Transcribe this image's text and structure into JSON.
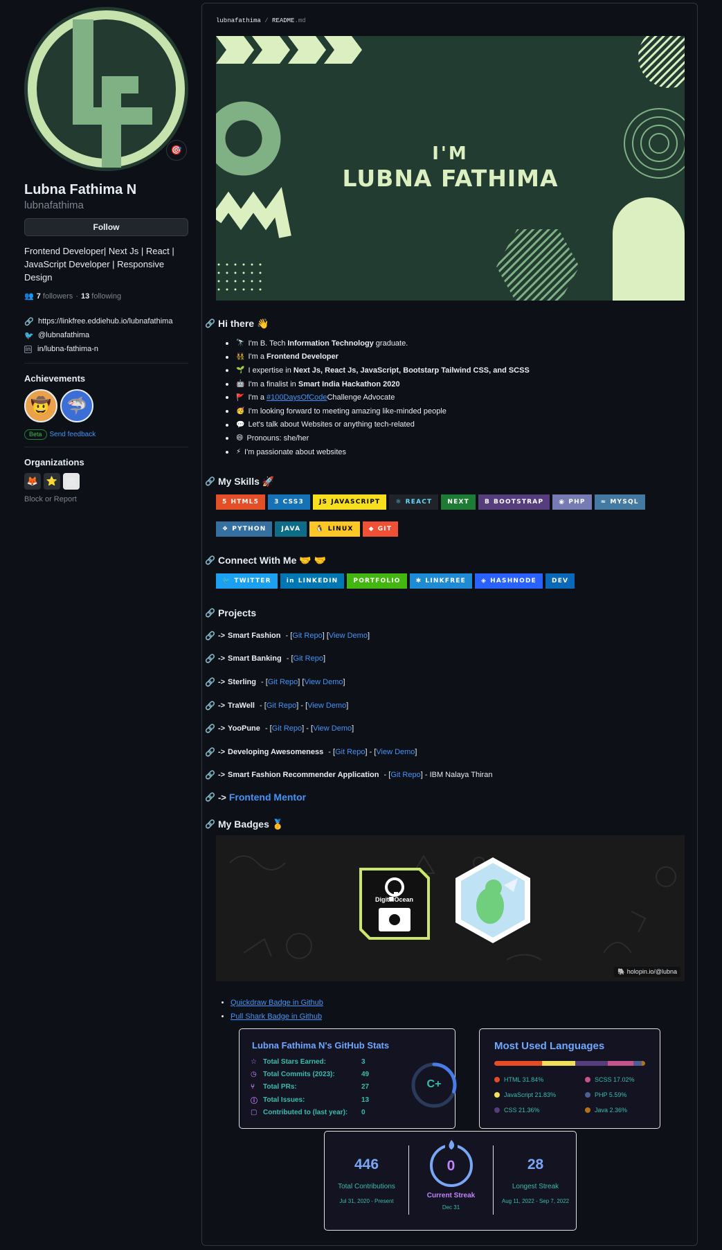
{
  "profile": {
    "full_name": "Lubna Fathima N",
    "login": "lubnafathima",
    "follow_label": "Follow",
    "bio": "Frontend Developer| Next Js | React | JavaScript Developer | Responsive Design",
    "followers_count": "7",
    "followers_label": "followers",
    "following_count": "13",
    "following_label": "following",
    "website": "https://linkfree.eddiehub.io/lubnafathima",
    "twitter": "@lubnafathima",
    "linkedin": "in/lubna-fathima-n",
    "status_emoji": "🎯"
  },
  "achievements": {
    "title": "Achievements",
    "items": [
      {
        "emoji": "🤠",
        "name": "Quickdraw"
      },
      {
        "emoji": "🦈",
        "name": "Pull Shark"
      }
    ],
    "beta_label": "Beta",
    "feedback_label": "Send feedback"
  },
  "organizations": {
    "title": "Organizations",
    "items": [
      "🦊",
      "⭐",
      "🏛"
    ],
    "block_report": "Block or Report"
  },
  "readme": {
    "owner": "lubnafathima",
    "file": "README",
    "ext": ".md",
    "banner_line1": "I'M",
    "banner_line2": "LUBNA FATHIMA",
    "hi_title": "Hi there",
    "hi_emoji": "👋",
    "intro": [
      {
        "emoji": "🔭",
        "pre": "I'm B. Tech ",
        "bold": "Information Technology",
        "post": " graduate."
      },
      {
        "emoji": "👯",
        "pre": "I'm a ",
        "bold": "Frontend Developer",
        "post": ""
      },
      {
        "emoji": "🌱",
        "pre": "I expertise in ",
        "bold": "Next Js, React Js, JavaScript, Bootstarp Tailwind CSS, and SCSS",
        "post": ""
      },
      {
        "emoji": "🤖",
        "pre": "I'm a finalist in ",
        "bold": "Smart India Hackathon 2020",
        "post": ""
      },
      {
        "emoji": "🚩",
        "pre": "I'm a ",
        "link": "#100DaysOfCode",
        "post": " Challenge Advocate"
      },
      {
        "emoji": "🥳",
        "pre": "I'm looking forward to meeting amazing like-minded people",
        "post": ""
      },
      {
        "emoji": "💬",
        "pre": "Let's talk about Websites or anything tech-related",
        "post": ""
      },
      {
        "emoji": "😄",
        "pre": "Pronouns: she/her",
        "post": ""
      },
      {
        "emoji": "⚡",
        "pre": "I'm passionate about websites",
        "post": ""
      }
    ],
    "skills_title": "My Skills",
    "skills_emoji": "🚀",
    "skills_row1": [
      {
        "label": "HTML5",
        "icon": "5",
        "color": "#e34f26"
      },
      {
        "label": "CSS3",
        "icon": "3",
        "color": "#1572b6"
      },
      {
        "label": "JAVASCRIPT",
        "icon": "JS",
        "color": "#f7df1e",
        "text": "#000000"
      },
      {
        "label": "REACT",
        "icon": "⚛",
        "color": "#20232a",
        "text": "#61dafb"
      },
      {
        "label": "NEXT",
        "icon": "",
        "color": "#1e7b34"
      },
      {
        "label": "BOOTSTRAP",
        "icon": "B",
        "color": "#563d7c"
      },
      {
        "label": "PHP",
        "icon": "◉",
        "color": "#777bb4"
      },
      {
        "label": "MYSQL",
        "icon": "≈",
        "color": "#4479a1"
      }
    ],
    "skills_row2": [
      {
        "label": "PYTHON",
        "icon": "❖",
        "color": "#3670a0"
      },
      {
        "label": "JAVA",
        "icon": "",
        "color": "#0d6c87"
      },
      {
        "label": "LINUX",
        "icon": "🐧",
        "color": "#fcc624",
        "text": "#000000"
      },
      {
        "label": "GIT",
        "icon": "◆",
        "color": "#f05033"
      }
    ],
    "connect_title": "Connect With Me",
    "connect_emoji": "🤝 🤝",
    "connect": [
      {
        "label": "TWITTER",
        "icon": "🐦",
        "color": "#1ca0f2"
      },
      {
        "label": "LINKEDIN",
        "icon": "in",
        "color": "#0077b5"
      },
      {
        "label": "PORTFOLIO",
        "icon": "",
        "color": "#43b70f"
      },
      {
        "label": "LINKFREE",
        "icon": "✱",
        "color": "#1f8bd5"
      },
      {
        "label": "HASHNODE",
        "icon": "◈",
        "color": "#2962ff"
      },
      {
        "label": "DEV",
        "icon": "",
        "color": "#0a68b8"
      }
    ],
    "projects_title": "Projects",
    "projects": [
      {
        "name": "Smart Fashion",
        "sep1": " - [",
        "l1": "Git Repo",
        "mid": "] [",
        "l2": "View Demo",
        "end": "]"
      },
      {
        "name": "Smart Banking",
        "sep1": " - [",
        "l1": "Git Repo",
        "mid": "]",
        "l2": "",
        "end": ""
      },
      {
        "name": "Sterling",
        "sep1": " - [",
        "l1": "Git Repo",
        "mid": "] [",
        "l2": "View Demo",
        "end": "]"
      },
      {
        "name": "TraWell",
        "sep1": " - [",
        "l1": "Git Repo",
        "mid": "] - [",
        "l2": "View Demo",
        "end": "]"
      },
      {
        "name": "YooPune",
        "sep1": " - [",
        "l1": "Git Repo",
        "mid": "] - [",
        "l2": "View Demo",
        "end": "]"
      },
      {
        "name": "Developing Awesomeness",
        "sep1": " - [",
        "l1": "Git Repo",
        "mid": "] - [",
        "l2": "View Demo",
        "end": "]"
      },
      {
        "name": "Smart Fashion Recommender Application",
        "sep1": " - [",
        "l1": "Git Repo",
        "mid": "] - IBM Nalaya Thiran",
        "l2": "",
        "end": ""
      }
    ],
    "arrow": "->",
    "frontend_mentor": "Frontend Mentor",
    "badges_title": "My Badges",
    "badges_emoji": "🥇",
    "holopin_url": "🐘 holopin.io/@lubna",
    "holopin_badge1": "DigitalOcean",
    "badge_links": [
      "Quickdraw Badge in Github",
      "Pull Shark Badge in Github"
    ]
  },
  "stats": {
    "title": "Lubna Fathima N's GitHub Stats",
    "rows": [
      {
        "icon": "☆",
        "label": "Total Stars Earned:",
        "value": "3"
      },
      {
        "icon": "◷",
        "label": "Total Commits (2023):",
        "value": "49"
      },
      {
        "icon": "⑂",
        "label": "Total PRs:",
        "value": "27"
      },
      {
        "icon": "ⓘ",
        "label": "Total Issues:",
        "value": "13"
      },
      {
        "icon": "▢",
        "label": "Contributed to (last year):",
        "value": "0"
      }
    ],
    "grade": "C+",
    "grade_progress": 0.3
  },
  "languages": {
    "title": "Most Used Languages",
    "items": [
      {
        "name": "HTML",
        "pct": 31.84,
        "label": "HTML 31.84%",
        "color": "#e34c26"
      },
      {
        "name": "JavaScript",
        "pct": 21.83,
        "label": "JavaScript 21.83%",
        "color": "#f1e05a"
      },
      {
        "name": "CSS",
        "pct": 21.36,
        "label": "CSS 21.36%",
        "color": "#563d7c"
      },
      {
        "name": "SCSS",
        "pct": 17.02,
        "label": "SCSS 17.02%",
        "color": "#c6538c"
      },
      {
        "name": "PHP",
        "pct": 5.59,
        "label": "PHP 5.59%",
        "color": "#4f5d95"
      },
      {
        "name": "Java",
        "pct": 2.36,
        "label": "Java 2.36%",
        "color": "#b07219"
      }
    ]
  },
  "streak": {
    "total": "446",
    "total_label": "Total Contributions",
    "total_range": "Jul 31, 2020 - Present",
    "current": "0",
    "current_label": "Current Streak",
    "current_range": "Dec 31",
    "longest": "28",
    "longest_label": "Longest Streak",
    "longest_range": "Aug 11, 2022 - Sep 7, 2022"
  },
  "colors": {
    "accent": "#4493f8",
    "banner_bg": "#233c31",
    "banner_light": "#dcefc1",
    "banner_mid": "#7fb184",
    "card_bg": "#141321",
    "card_teal": "#38bdae",
    "card_title": "#fe428e"
  }
}
